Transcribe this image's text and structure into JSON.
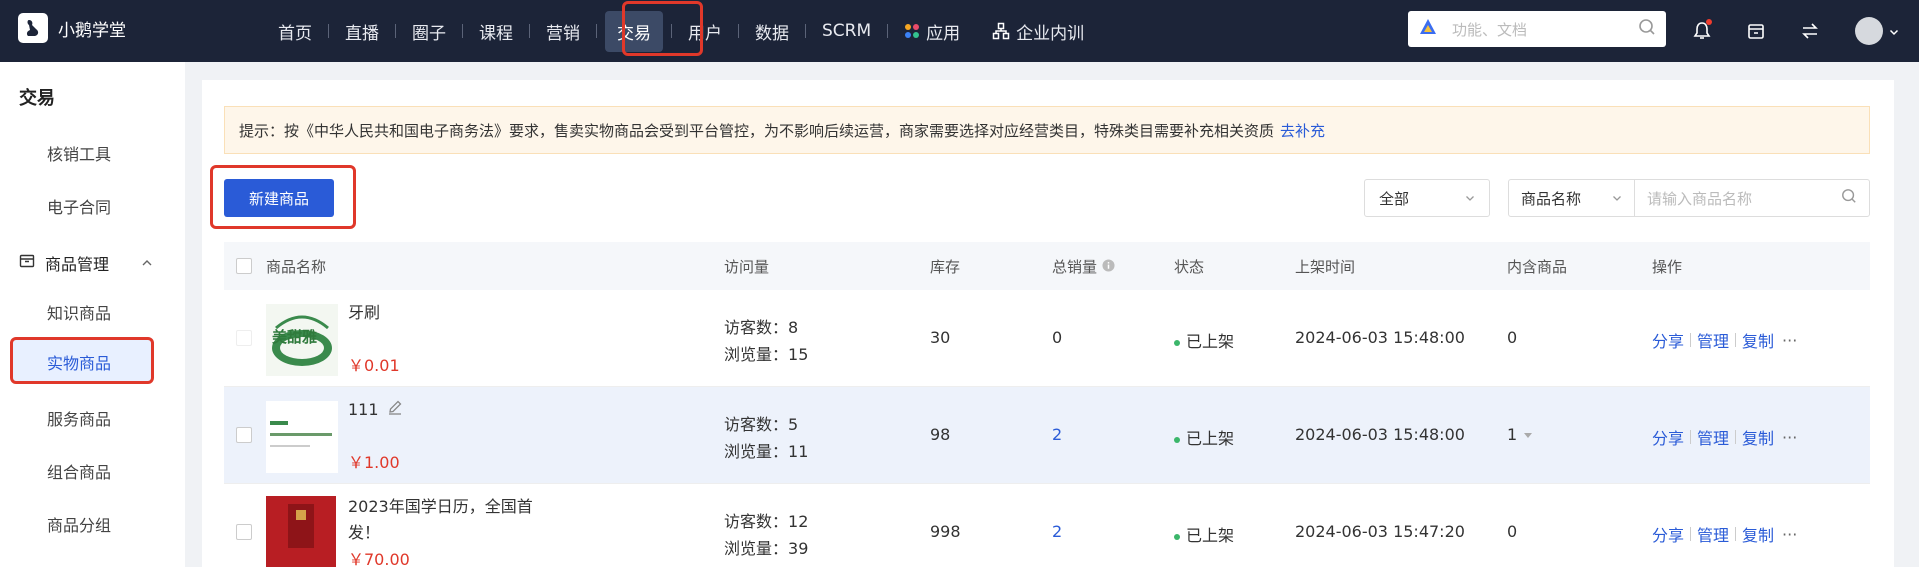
{
  "app": {
    "name": "小鹅学堂"
  },
  "nav": {
    "items": [
      {
        "label": "首页"
      },
      {
        "label": "直播"
      },
      {
        "label": "圈子"
      },
      {
        "label": "课程"
      },
      {
        "label": "营销"
      },
      {
        "label": "交易"
      },
      {
        "label": "用户"
      },
      {
        "label": "数据"
      },
      {
        "label": "SCRM"
      },
      {
        "label": "应用"
      },
      {
        "label": "企业内训"
      }
    ]
  },
  "search": {
    "placeholder": "功能、文档"
  },
  "sidebar": {
    "title": "交易",
    "items": [
      {
        "label": "核销工具"
      },
      {
        "label": "电子合同"
      }
    ],
    "group": {
      "label": "商品管理"
    },
    "group_items": [
      {
        "label": "知识商品"
      },
      {
        "label": "实物商品"
      },
      {
        "label": "服务商品"
      },
      {
        "label": "组合商品"
      },
      {
        "label": "商品分组"
      }
    ]
  },
  "notice": {
    "text": "提示：按《中华人民共和国电子商务法》要求，售卖实物商品会受到平台管控，为不影响后续运营，商家需要选择对应经营类目，特殊类目需要补充相关资质",
    "link": "去补充"
  },
  "toolbar": {
    "new_button": "新建商品",
    "status_filter": "全部",
    "field_filter": "商品名称",
    "search_placeholder": "请输入商品名称"
  },
  "table": {
    "headers": {
      "name": "商品名称",
      "visits": "访问量",
      "stock": "库存",
      "sales": "总销量",
      "status": "状态",
      "time": "上架时间",
      "contains": "内含商品",
      "ops": "操作"
    },
    "visitor_label": "访客数：",
    "view_label": "浏览量：",
    "op_share": "分享",
    "op_manage": "管理",
    "op_copy": "复制",
    "op_more": "···",
    "rows": [
      {
        "name": "牙刷",
        "price": "￥0.01",
        "visitors": "8",
        "views": "15",
        "stock": "30",
        "sales": "0",
        "status": "已上架",
        "time": "2024-06-03 15:48:00",
        "contains": "0",
        "thumb_text": "美甜雅"
      },
      {
        "name": "111",
        "price": "￥1.00",
        "visitors": "5",
        "views": "11",
        "stock": "98",
        "sales": "2",
        "status": "已上架",
        "time": "2024-06-03 15:48:00",
        "contains": "1"
      },
      {
        "name_line1": "2023年国学日历，全国首",
        "name_line2": "发！",
        "price": "￥70.00",
        "visitors": "12",
        "views": "39",
        "stock": "998",
        "sales": "2",
        "status": "已上架",
        "time": "2024-06-03 15:47:20",
        "contains": "0"
      }
    ]
  }
}
